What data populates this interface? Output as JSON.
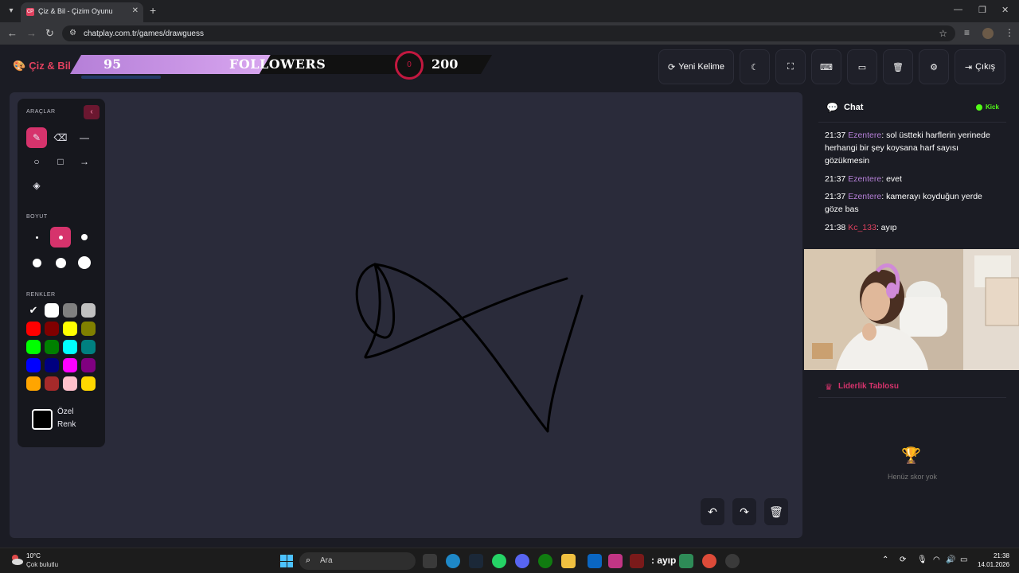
{
  "browser": {
    "tab_title": "Çiz & Bil - Çizim Oyunu",
    "tab_favicon": "CP",
    "url": "chatplay.com.tr/games/drawguess"
  },
  "header": {
    "brand": "Çiz & Bil",
    "followers_count": "95",
    "followers_label": "FOLLOWERS",
    "followers_ring": "0",
    "followers_goal": "200",
    "followers_progress": 0.475,
    "buttons": {
      "new_word": "Yeni Kelime",
      "exit": "Çıkış"
    }
  },
  "tools": {
    "tools_label": "ARAÇLAR",
    "size_label": "BOYUT",
    "colors_label": "RENKLER",
    "custom_color_line1": "Özel",
    "custom_color_line2": "Renk",
    "palette": [
      "#000000",
      "#ffffff",
      "#808080",
      "#c0c0c0",
      "#ff0000",
      "#800000",
      "#ffff00",
      "#808000",
      "#00ff00",
      "#008000",
      "#00ffff",
      "#008080",
      "#0000ff",
      "#000080",
      "#ff00ff",
      "#800080",
      "#ffa500",
      "#a52a2a",
      "#ffc0cb",
      "#ffd700"
    ],
    "selected_color": "#000000"
  },
  "chat": {
    "title": "Chat",
    "platform": "Kick",
    "messages": [
      {
        "time": "21:37",
        "user": "Ezentere",
        "text": ": sol üstteki harflerin yerinede herhangi bir şey koysana harf sayısı gözükmesin"
      },
      {
        "time": "21:37",
        "user": "Ezentere",
        "text": ": evet"
      },
      {
        "time": "21:37",
        "user": "Ezentere",
        "text": ": kamerayı koyduğun yerde göze bas"
      },
      {
        "time": "21:38",
        "user": "Kc_133",
        "text": ": ayıp"
      }
    ]
  },
  "leaderboard": {
    "title": "Liderlik Tablosu",
    "empty": "Henüz skor yok"
  },
  "taskbar": {
    "temperature": "10°C",
    "weather": "Çok bulutlu",
    "search_placeholder": "Ara",
    "overlay_text": ": ayıp",
    "time": "21:38",
    "date": "14.01.2026"
  }
}
